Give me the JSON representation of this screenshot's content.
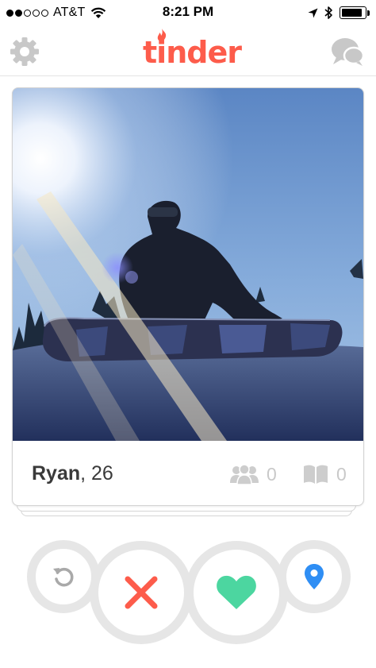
{
  "status_bar": {
    "carrier": "AT&T",
    "time": "8:21 PM",
    "signal_bars_filled": 2,
    "signal_bars_total": 5,
    "battery_level": 0.9
  },
  "navbar": {
    "logo_text": "tinder",
    "brand_color": "#fd5c4b",
    "left_icon": "gear-icon",
    "right_icon": "chat-bubbles-icon"
  },
  "profile_card": {
    "name": "Ryan",
    "age_text": ", 26",
    "photo_description_icon": "snowboard-photo",
    "shared_friends": {
      "icon": "friends-icon",
      "count": "0"
    },
    "shared_interests": {
      "icon": "interests-book-icon",
      "count": "0"
    }
  },
  "actions": {
    "rewind_icon": "rewind-icon",
    "nope_icon": "close-x-icon",
    "like_icon": "heart-icon",
    "location_icon": "location-pin-icon",
    "colors": {
      "rewind": "#a9a9a9",
      "nope": "#fd5c4b",
      "like": "#4cd6a0",
      "location": "#2f8ef4",
      "ring": "#e6e6e6"
    }
  }
}
